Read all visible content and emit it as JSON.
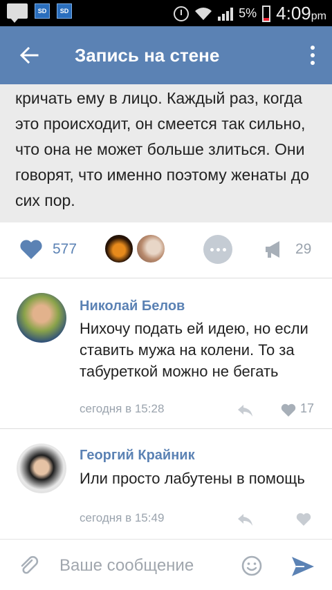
{
  "status_bar": {
    "sd_icon_1": "SD",
    "sd_icon_2": "SD",
    "battery_percent": "5%",
    "time": "4:09",
    "time_suffix": "pm"
  },
  "app_bar": {
    "title": "Запись на стене",
    "back_icon": "arrow-left-icon",
    "menu_icon": "more-vertical-icon"
  },
  "post": {
    "text": "кричать ему в лицо. Каждый раз, когда это происходит, он смеется так сильно, что она не может больше злиться. Они говорят, что именно поэтому женаты до сих пор."
  },
  "actions": {
    "likes": "577",
    "reposts": "29"
  },
  "comments": [
    {
      "author": "Николай Белов",
      "text": "Нихочу подать ей идею, но если ставить мужа на колени. То за табуреткой можно не бегать",
      "time": "сегодня в 15:28",
      "likes": "17"
    },
    {
      "author": "Георгий Крайник",
      "text": "Или просто лабутены в помощь",
      "time": "сегодня в 15:49",
      "likes": ""
    }
  ],
  "composer": {
    "placeholder": "Ваше сообщение"
  },
  "colors": {
    "accent": "#5b82b4",
    "post_bg": "#ebebeb",
    "muted": "#9aa3ad"
  }
}
